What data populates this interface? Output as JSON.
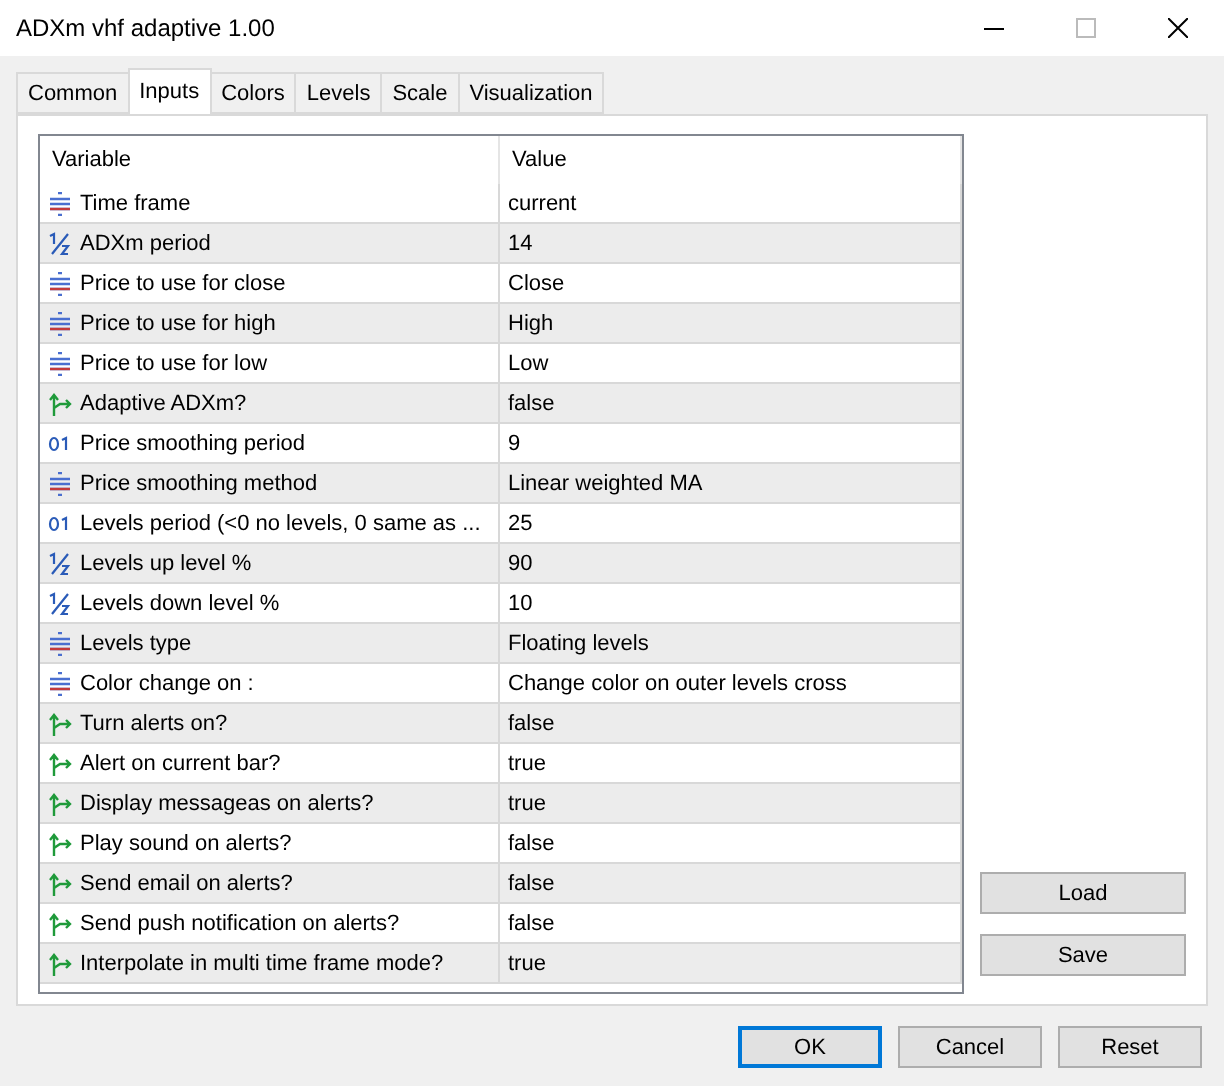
{
  "window": {
    "title": "ADXm vhf adaptive 1.00"
  },
  "tabs": [
    {
      "label": "Common",
      "selected": false
    },
    {
      "label": "Inputs",
      "selected": true
    },
    {
      "label": "Colors",
      "selected": false
    },
    {
      "label": "Levels",
      "selected": false
    },
    {
      "label": "Scale",
      "selected": false
    },
    {
      "label": "Visualization",
      "selected": false
    }
  ],
  "table": {
    "columns": [
      "Variable",
      "Value"
    ],
    "rows": [
      {
        "kind": "enum",
        "variable": "Time frame",
        "value": "current"
      },
      {
        "kind": "double",
        "variable": "ADXm period",
        "value": "14"
      },
      {
        "kind": "enum",
        "variable": "Price to use for close",
        "value": "Close"
      },
      {
        "kind": "enum",
        "variable": "Price to use for high",
        "value": "High"
      },
      {
        "kind": "enum",
        "variable": "Price to use for low",
        "value": "Low"
      },
      {
        "kind": "bool",
        "variable": "Adaptive ADXm?",
        "value": "false"
      },
      {
        "kind": "int",
        "variable": "Price smoothing period",
        "value": "9"
      },
      {
        "kind": "enum",
        "variable": "Price smoothing method",
        "value": "Linear weighted MA"
      },
      {
        "kind": "int",
        "variable": "Levels period (<0 no levels, 0 same as ...",
        "value": "25"
      },
      {
        "kind": "double",
        "variable": "Levels up level %",
        "value": "90"
      },
      {
        "kind": "double",
        "variable": "Levels down level %",
        "value": "10"
      },
      {
        "kind": "enum",
        "variable": "Levels type",
        "value": "Floating levels"
      },
      {
        "kind": "enum",
        "variable": "Color change on :",
        "value": "Change color on outer levels cross"
      },
      {
        "kind": "bool",
        "variable": "Turn alerts on?",
        "value": "false"
      },
      {
        "kind": "bool",
        "variable": "Alert on current bar?",
        "value": "true"
      },
      {
        "kind": "bool",
        "variable": "Display messageas on alerts?",
        "value": "true"
      },
      {
        "kind": "bool",
        "variable": "Play sound on alerts?",
        "value": "false"
      },
      {
        "kind": "bool",
        "variable": "Send email on alerts?",
        "value": "false"
      },
      {
        "kind": "bool",
        "variable": "Send push notification on alerts?",
        "value": "false"
      },
      {
        "kind": "bool",
        "variable": "Interpolate in multi time frame mode?",
        "value": "true"
      }
    ]
  },
  "side_buttons": [
    "Load",
    "Save"
  ],
  "buttons": [
    {
      "label": "OK",
      "selected": true
    },
    {
      "label": "Cancel",
      "selected": false
    },
    {
      "label": "Reset",
      "selected": false
    }
  ]
}
